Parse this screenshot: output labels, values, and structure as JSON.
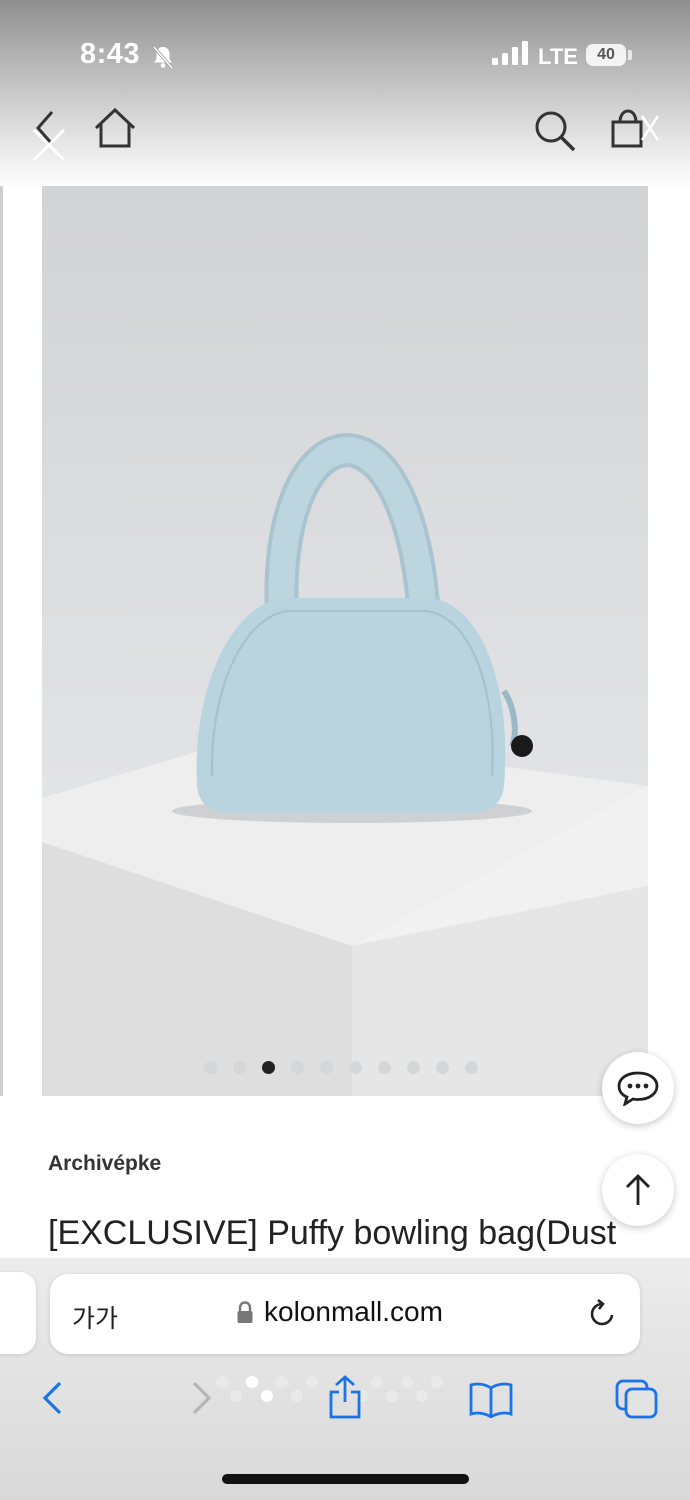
{
  "status_bar": {
    "time": "8:43",
    "network": "LTE",
    "battery": "40"
  },
  "header": {
    "icons": [
      "back-icon",
      "close-icon",
      "home-icon",
      "search-icon",
      "shopping-bag-icon"
    ]
  },
  "product": {
    "image_description": "light blue puffy bowling bag on white pedestal",
    "carousel_total": 10,
    "carousel_active_index": 2,
    "brand": "Archivépke",
    "title": "[EXCLUSIVE] Puffy bowling bag(Dust"
  },
  "floating_buttons": {
    "chat": "chat-icon",
    "scroll_top": "arrow-up-icon"
  },
  "browser": {
    "text_size_label": "가가",
    "domain": "kolonmall.com",
    "toolbar_icons": [
      "back-icon",
      "forward-icon",
      "share-icon",
      "bookmarks-icon",
      "tabs-icon"
    ]
  },
  "colors": {
    "accent": "#1a73e8",
    "bag": "#b9d3df"
  }
}
